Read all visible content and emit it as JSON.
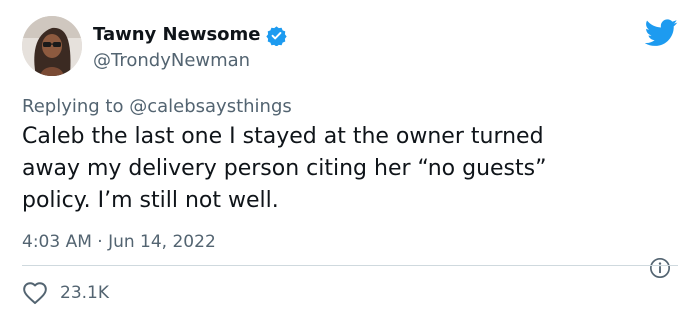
{
  "author": {
    "display_name": "Tawny Newsome",
    "handle": "@TrondyNewman",
    "verified": true,
    "avatar": "avatar-photo"
  },
  "reply": {
    "prefix": "Replying to",
    "mention": "@calebsaysthings"
  },
  "tweet": {
    "text": "Caleb the last one I stayed at the owner turned\naway my delivery person citing her “no guests”\npolicy. I’m still not well."
  },
  "meta": {
    "timestamp": "4:03 AM · Jun 14, 2022"
  },
  "engagement": {
    "likes": "23.1K"
  },
  "icons": {
    "brand": "twitter-bird-icon",
    "verified": "verified-badge-icon",
    "info": "info-icon",
    "like": "heart-icon"
  },
  "colors": {
    "brand_blue": "#1d9bf0",
    "secondary_text": "#536471",
    "primary_text": "#0f1419",
    "divider": "#cfd9de"
  }
}
